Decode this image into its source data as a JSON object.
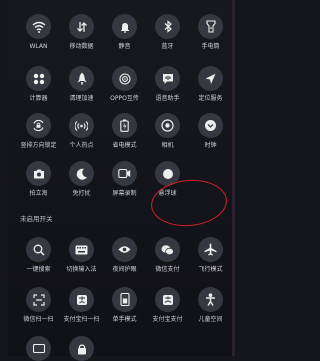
{
  "enabled": [
    {
      "label": "WLAN",
      "icon": "wifi-icon"
    },
    {
      "label": "移动数据",
      "icon": "mobile-data-icon"
    },
    {
      "label": "静音",
      "icon": "mute-bell-icon"
    },
    {
      "label": "蓝牙",
      "icon": "bluetooth-icon"
    },
    {
      "label": "手电筒",
      "icon": "flashlight-icon"
    },
    {
      "label": "计算器",
      "icon": "calculator-icon"
    },
    {
      "label": "清理加速",
      "icon": "rocket-icon"
    },
    {
      "label": "OPPO互传",
      "icon": "oppo-share-icon"
    },
    {
      "label": "语音助手",
      "icon": "voice-assistant-icon"
    },
    {
      "label": "定位服务",
      "icon": "location-icon"
    },
    {
      "label": "竖排方向锁定",
      "icon": "rotation-lock-icon"
    },
    {
      "label": "个人热点",
      "icon": "hotspot-icon"
    },
    {
      "label": "省电模式",
      "icon": "battery-icon"
    },
    {
      "label": "相机",
      "icon": "camera-icon"
    },
    {
      "label": "时钟",
      "icon": "clock-icon"
    },
    {
      "label": "拍立淘",
      "icon": "photo-shop-icon"
    },
    {
      "label": "免打扰",
      "icon": "moon-icon"
    },
    {
      "label": "屏幕录制",
      "icon": "screen-record-icon"
    },
    {
      "label": "悬浮球",
      "icon": "floating-ball-icon"
    }
  ],
  "disabled_title": "未启用开关",
  "disabled": [
    {
      "label": "一键搜索",
      "icon": "search-icon"
    },
    {
      "label": "切换输入法",
      "icon": "keyboard-icon"
    },
    {
      "label": "夜间护眼",
      "icon": "eye-icon"
    },
    {
      "label": "微信支付",
      "icon": "wechat-pay-icon"
    },
    {
      "label": "飞行模式",
      "icon": "airplane-icon"
    },
    {
      "label": "微信扫一扫",
      "icon": "wechat-scan-icon"
    },
    {
      "label": "支付宝扫一扫",
      "icon": "alipay-scan-icon"
    },
    {
      "label": "单手模式",
      "icon": "one-hand-icon"
    },
    {
      "label": "支付宝支付",
      "icon": "alipay-pay-icon"
    },
    {
      "label": "儿童空间",
      "icon": "kids-space-icon"
    }
  ],
  "colors": {
    "tile": "#363841",
    "text": "#d2d2d8",
    "highlight": "#d21f2a"
  }
}
